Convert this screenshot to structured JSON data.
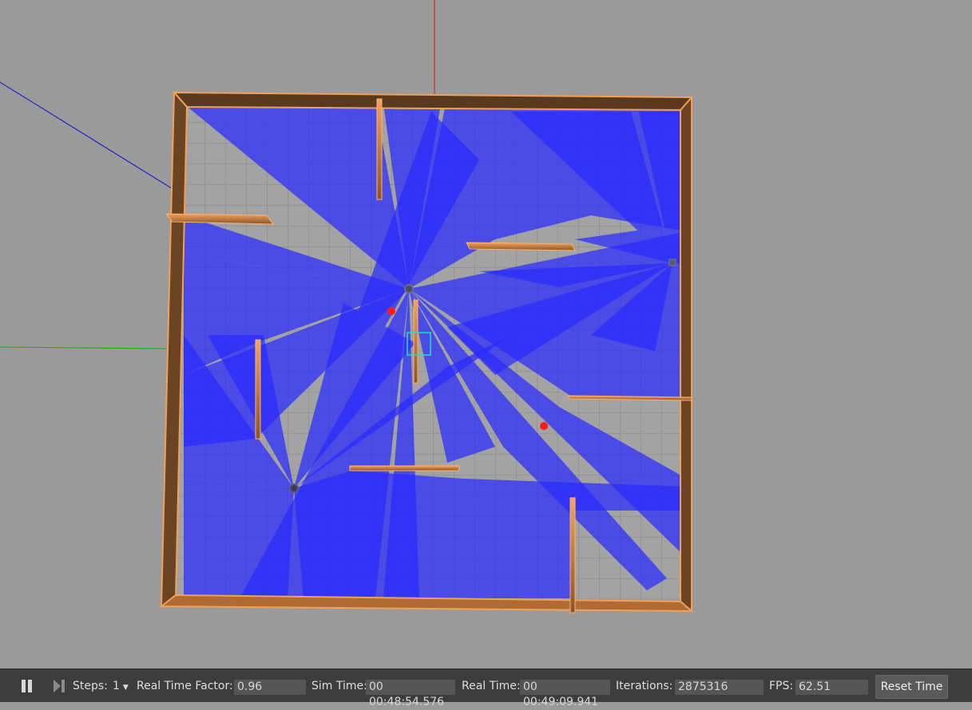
{
  "colors": {
    "background": "#9a9a9a",
    "laser": "#2a2aff",
    "wall": "#c87a3a",
    "wall_highlight": "#f7a660",
    "marker": "#ff1a1a",
    "selection": "#22e0c0",
    "toolbar": "#3d3d3d"
  },
  "toolbar": {
    "pause_icon": "pause-icon",
    "step_icon": "step-forward-icon",
    "steps_label": "Steps:",
    "steps_value": "1",
    "rtf_label": "Real Time Factor:",
    "rtf_value": "0.96",
    "sim_time_label": "Sim Time:",
    "sim_time_value": "00 00:48:54.576",
    "real_time_label": "Real Time:",
    "real_time_value": "00 00:49:09.941",
    "iterations_label": "Iterations:",
    "iterations_value": "2875316",
    "fps_label": "FPS:",
    "fps_value": "62.51",
    "reset_label": "Reset Time"
  }
}
